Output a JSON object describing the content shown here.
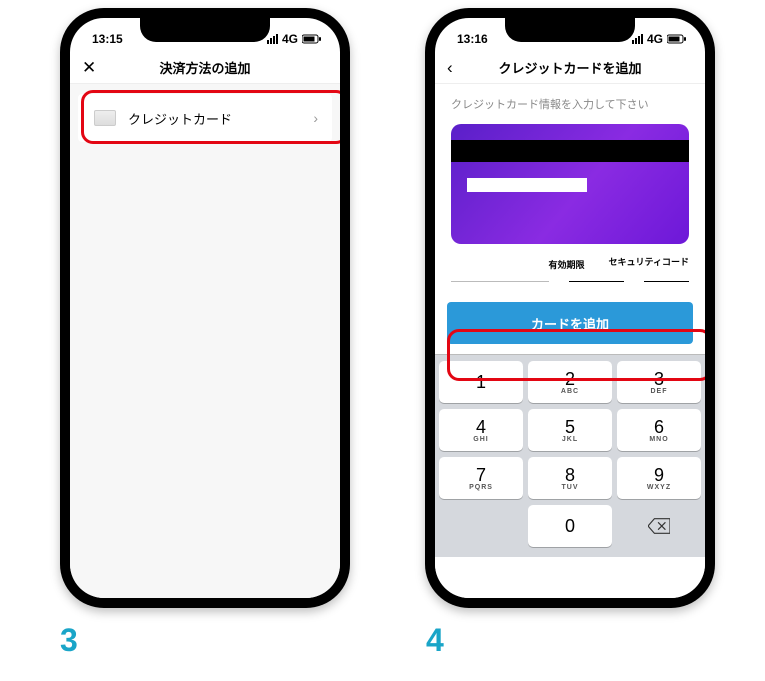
{
  "steps": {
    "three": "3",
    "four": "4"
  },
  "screen1": {
    "status_time": "13:15",
    "status_net": "4G",
    "nav_close": "✕",
    "nav_title": "決済方法の追加",
    "row_label": "クレジットカード"
  },
  "screen2": {
    "status_time": "13:16",
    "status_net": "4G",
    "nav_title": "クレジットカードを追加",
    "subtext": "クレジットカード情報を入力して下さい",
    "label_expiry": "有効期限",
    "label_cvv": "セキュリティコード",
    "button_label": "カードを追加",
    "keypad": [
      [
        {
          "n": "1",
          "s": ""
        },
        {
          "n": "2",
          "s": "ABC"
        },
        {
          "n": "3",
          "s": "DEF"
        }
      ],
      [
        {
          "n": "4",
          "s": "GHI"
        },
        {
          "n": "5",
          "s": "JKL"
        },
        {
          "n": "6",
          "s": "MNO"
        }
      ],
      [
        {
          "n": "7",
          "s": "PQRS"
        },
        {
          "n": "8",
          "s": "TUV"
        },
        {
          "n": "9",
          "s": "WXYZ"
        }
      ],
      [
        {
          "n": "",
          "s": "",
          "blank": true
        },
        {
          "n": "0",
          "s": ""
        },
        {
          "n": "",
          "s": "",
          "del": true
        }
      ]
    ]
  }
}
